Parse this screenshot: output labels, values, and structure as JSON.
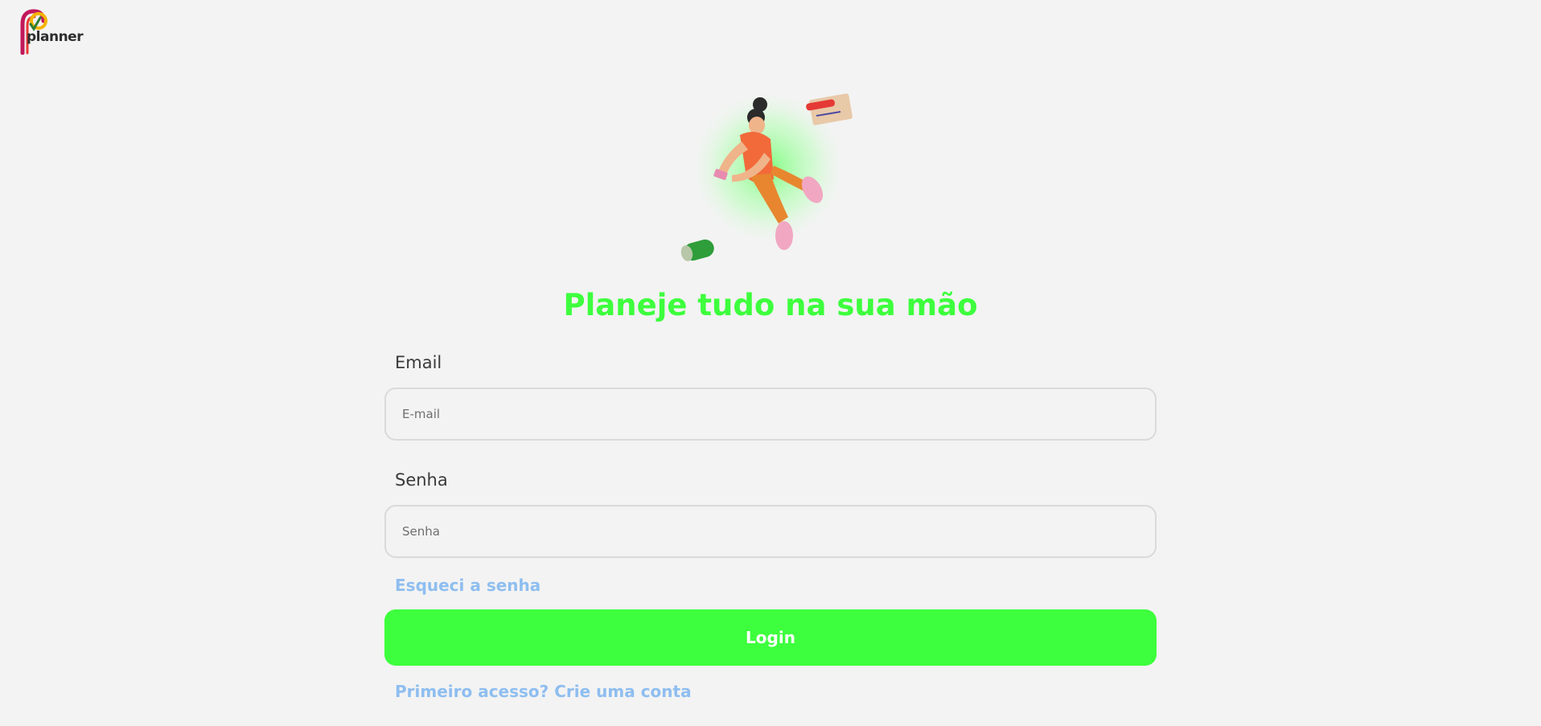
{
  "brand": {
    "logo_text": "planner",
    "logo_icon": "planner-logo-icon"
  },
  "hero": {
    "illustration": "jumping-person-illustration"
  },
  "headline": "Planeje tudo na sua mão",
  "form": {
    "email_label": "Email",
    "email_placeholder": "E-mail",
    "email_value": "",
    "password_label": "Senha",
    "password_placeholder": "Senha",
    "password_value": "",
    "forgot_link": "Esqueci a senha",
    "login_button": "Login",
    "signup_link": "Primeiro acesso? Crie uma conta"
  },
  "colors": {
    "accent_green": "#3dff3d",
    "link_blue": "#8ebef0",
    "background": "#f3f3f3"
  }
}
